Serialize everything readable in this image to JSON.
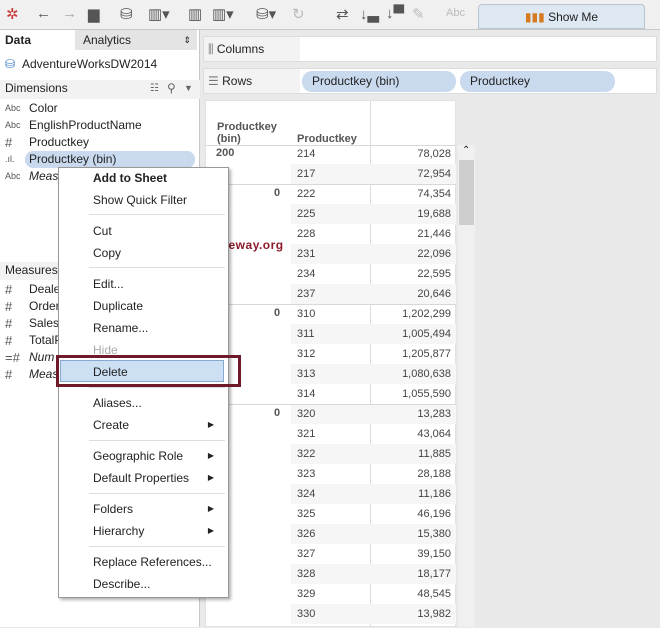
{
  "toolbar": {
    "icons": [
      "tableau-logo-icon",
      "back-icon",
      "forward-icon",
      "save-icon",
      "new-datasource-icon",
      "new-worksheet-icon",
      "duplicate-sheet-icon",
      "clear-sheet-icon",
      "pause-updates-icon",
      "refresh-icon",
      "swap-icon",
      "sort-asc-icon",
      "sort-desc-icon",
      "highlight-icon",
      "labels-icon"
    ],
    "abc": "Abc",
    "show_me": "Show Me"
  },
  "left": {
    "tab_data": "Data",
    "tab_analytics": "Analytics",
    "datasource": "AdventureWorksDW2014",
    "dimensions_label": "Dimensions",
    "dimensions": [
      {
        "type": "Abc",
        "name": "Color"
      },
      {
        "type": "Abc",
        "name": "EnglishProductName"
      },
      {
        "type": "#",
        "name": "Productkey"
      },
      {
        "type": ".ıl.",
        "name": "Productkey (bin)"
      },
      {
        "type": "Abc",
        "name": "Meas"
      }
    ],
    "measures_label": "Measures",
    "measures": [
      {
        "type": "#",
        "name": "Deale"
      },
      {
        "type": "#",
        "name": "Order"
      },
      {
        "type": "#",
        "name": "SalesA"
      },
      {
        "type": "#",
        "name": "TotalP"
      },
      {
        "type": "=#",
        "name": "Num"
      },
      {
        "type": "#",
        "name": "Meas"
      }
    ]
  },
  "shelves": {
    "columns": "Columns",
    "rows": "Rows",
    "row_pills": [
      "Productkey (bin)",
      "Productkey"
    ]
  },
  "table": {
    "headers": [
      "Productkey (bin)",
      "Productkey"
    ],
    "header_line1": "Productkey",
    "header_line2": "(bin)",
    "bins": [
      {
        "label": "200",
        "row": 0
      },
      {
        "label": "0",
        "row": 2
      },
      {
        "label": "0",
        "row": 8
      },
      {
        "label": "0",
        "row": 13
      }
    ],
    "rows": [
      [
        "214",
        "78,028"
      ],
      [
        "217",
        "72,954"
      ],
      [
        "222",
        "74,354"
      ],
      [
        "225",
        "19,688"
      ],
      [
        "228",
        "21,446"
      ],
      [
        "231",
        "22,096"
      ],
      [
        "234",
        "22,595"
      ],
      [
        "237",
        "20,646"
      ],
      [
        "310",
        "1,202,299"
      ],
      [
        "311",
        "1,005,494"
      ],
      [
        "312",
        "1,205,877"
      ],
      [
        "313",
        "1,080,638"
      ],
      [
        "314",
        "1,055,590"
      ],
      [
        "320",
        "13,283"
      ],
      [
        "321",
        "43,064"
      ],
      [
        "322",
        "11,885"
      ],
      [
        "323",
        "28,188"
      ],
      [
        "324",
        "11,186"
      ],
      [
        "325",
        "46,196"
      ],
      [
        "326",
        "15,380"
      ],
      [
        "327",
        "39,150"
      ],
      [
        "328",
        "18,177"
      ],
      [
        "329",
        "48,545"
      ],
      [
        "330",
        "13,982"
      ]
    ]
  },
  "menu": {
    "items": [
      "Add to Sheet",
      "Show Quick Filter",
      "Cut",
      "Copy",
      "Edit...",
      "Duplicate",
      "Rename...",
      "Hide",
      "Delete",
      "Aliases...",
      "Create",
      "Geographic Role",
      "Default Properties",
      "Folders",
      "Hierarchy",
      "Replace References...",
      "Describe..."
    ],
    "highlighted": "Delete",
    "disabled": [
      "Hide"
    ]
  },
  "watermark": "©tutorialgateway.org",
  "colors": {
    "highlight": "#cde0f3",
    "pill": "#c9d9ee",
    "annotation_box": "#6e1a2a"
  }
}
